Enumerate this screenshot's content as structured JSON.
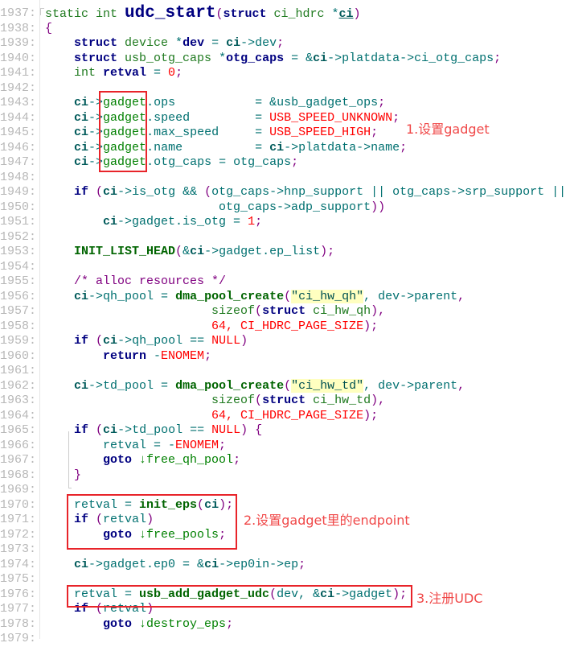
{
  "editor": {
    "lines": [
      {
        "n": "1937:",
        "t": [
          [
            "t",
            "static int "
          ],
          [
            "big",
            "udc_start"
          ],
          [
            "p",
            "("
          ],
          [
            "k",
            "struct"
          ],
          [
            "t",
            " ci_hdrc "
          ],
          [
            "o",
            "*"
          ],
          [
            "c u",
            "ci"
          ],
          [
            "p",
            ")"
          ]
        ]
      },
      {
        "n": "1938:",
        "t": [
          [
            "p",
            "{"
          ]
        ]
      },
      {
        "n": "1939:",
        "t": [
          [
            "t",
            "    "
          ],
          [
            "k",
            "struct"
          ],
          [
            "t",
            " device "
          ],
          [
            "o",
            "*"
          ],
          [
            "v",
            "dev"
          ],
          [
            "o",
            " = "
          ],
          [
            "c",
            "ci"
          ],
          [
            "m",
            "->dev"
          ],
          [
            "p",
            ";"
          ]
        ]
      },
      {
        "n": "1940:",
        "t": [
          [
            "t",
            "    "
          ],
          [
            "k",
            "struct"
          ],
          [
            "t",
            " usb_otg_caps "
          ],
          [
            "o",
            "*"
          ],
          [
            "v",
            "otg_caps"
          ],
          [
            "o",
            " = &"
          ],
          [
            "c",
            "ci"
          ],
          [
            "m",
            "->platdata->ci_otg_caps"
          ],
          [
            "p",
            ";"
          ]
        ]
      },
      {
        "n": "1941:",
        "t": [
          [
            "t",
            "    int "
          ],
          [
            "v",
            "retval"
          ],
          [
            "o",
            " = "
          ],
          [
            "n",
            "0"
          ],
          [
            "p",
            ";"
          ]
        ]
      },
      {
        "n": "1942:",
        "t": []
      },
      {
        "n": "1943:",
        "t": [
          [
            "t",
            "    "
          ],
          [
            "c",
            "ci"
          ],
          [
            "m",
            "->"
          ],
          [
            "g",
            "gadget"
          ],
          [
            "m",
            ".ops           = &usb_gadget_ops"
          ],
          [
            "p",
            ";"
          ]
        ]
      },
      {
        "n": "1944:",
        "t": [
          [
            "t",
            "    "
          ],
          [
            "c",
            "ci"
          ],
          [
            "m",
            "->"
          ],
          [
            "g",
            "gadget"
          ],
          [
            "m",
            ".speed         = "
          ],
          [
            "n",
            "USB_SPEED_UNKNOWN"
          ],
          [
            "p",
            ";"
          ]
        ]
      },
      {
        "n": "1945:",
        "t": [
          [
            "t",
            "    "
          ],
          [
            "c",
            "ci"
          ],
          [
            "m",
            "->"
          ],
          [
            "g",
            "gadget"
          ],
          [
            "m",
            ".max_speed     = "
          ],
          [
            "n",
            "USB_SPEED_HIGH"
          ],
          [
            "p",
            ";"
          ]
        ]
      },
      {
        "n": "1946:",
        "t": [
          [
            "t",
            "    "
          ],
          [
            "c",
            "ci"
          ],
          [
            "m",
            "->"
          ],
          [
            "g",
            "gadget"
          ],
          [
            "m",
            ".name          = "
          ],
          [
            "c",
            "ci"
          ],
          [
            "m",
            "->platdata->name"
          ],
          [
            "p",
            ";"
          ]
        ]
      },
      {
        "n": "1947:",
        "t": [
          [
            "t",
            "    "
          ],
          [
            "c",
            "ci"
          ],
          [
            "m",
            "->"
          ],
          [
            "g",
            "gadget"
          ],
          [
            "m",
            ".otg_caps = otg_caps"
          ],
          [
            "p",
            ";"
          ]
        ]
      },
      {
        "n": "1948:",
        "t": []
      },
      {
        "n": "1949:",
        "t": [
          [
            "t",
            "    "
          ],
          [
            "k",
            "if"
          ],
          [
            "p",
            " ("
          ],
          [
            "c",
            "ci"
          ],
          [
            "m",
            "->is_otg && "
          ],
          [
            "p",
            "("
          ],
          [
            "m",
            "otg_caps->hnp_support || otg_caps->srp_support ||"
          ]
        ]
      },
      {
        "n": "1950:",
        "t": [
          [
            "m",
            "                        otg_caps->adp_support"
          ],
          [
            "p",
            "))"
          ]
        ]
      },
      {
        "n": "1951:",
        "t": [
          [
            "t",
            "        "
          ],
          [
            "c",
            "ci"
          ],
          [
            "m",
            "->gadget.is_otg = "
          ],
          [
            "n",
            "1"
          ],
          [
            "p",
            ";"
          ]
        ]
      },
      {
        "n": "1952:",
        "t": []
      },
      {
        "n": "1953:",
        "t": [
          [
            "t",
            "    "
          ],
          [
            "f",
            "INIT_LIST_HEAD"
          ],
          [
            "p",
            "("
          ],
          [
            "o",
            "&"
          ],
          [
            "c",
            "ci"
          ],
          [
            "m",
            "->gadget.ep_list"
          ],
          [
            "p",
            ");"
          ]
        ]
      },
      {
        "n": "1954:",
        "t": []
      },
      {
        "n": "1955:",
        "t": [
          [
            "cm",
            "    /* alloc resources */"
          ]
        ]
      },
      {
        "n": "1956:",
        "t": [
          [
            "t",
            "    "
          ],
          [
            "c",
            "ci"
          ],
          [
            "m",
            "->qh_pool = "
          ],
          [
            "f",
            "dma_pool_create"
          ],
          [
            "p",
            "("
          ],
          [
            "s",
            "\"ci_hw_qh\""
          ],
          [
            "m",
            ", dev->parent"
          ],
          [
            "p",
            ","
          ]
        ]
      },
      {
        "n": "1957:",
        "t": [
          [
            "t",
            "                       sizeof"
          ],
          [
            "p",
            "("
          ],
          [
            "k",
            "struct"
          ],
          [
            "t",
            " ci_hw_qh"
          ],
          [
            "p",
            "),"
          ]
        ]
      },
      {
        "n": "1958:",
        "t": [
          [
            "n",
            "                       64, CI_HDRC_PAGE_SIZE"
          ],
          [
            "p",
            ");"
          ]
        ]
      },
      {
        "n": "1959:",
        "t": [
          [
            "t",
            "    "
          ],
          [
            "k",
            "if"
          ],
          [
            "p",
            " ("
          ],
          [
            "c",
            "ci"
          ],
          [
            "m",
            "->qh_pool == "
          ],
          [
            "n",
            "NULL"
          ],
          [
            "p",
            ")"
          ]
        ]
      },
      {
        "n": "1960:",
        "t": [
          [
            "t",
            "        "
          ],
          [
            "k",
            "return"
          ],
          [
            "m",
            " -"
          ],
          [
            "n",
            "ENOMEM"
          ],
          [
            "p",
            ";"
          ]
        ]
      },
      {
        "n": "1961:",
        "t": []
      },
      {
        "n": "1962:",
        "t": [
          [
            "t",
            "    "
          ],
          [
            "c",
            "ci"
          ],
          [
            "m",
            "->td_pool = "
          ],
          [
            "f",
            "dma_pool_create"
          ],
          [
            "p",
            "("
          ],
          [
            "s",
            "\"ci_hw_td\""
          ],
          [
            "m",
            ", dev->parent"
          ],
          [
            "p",
            ","
          ]
        ]
      },
      {
        "n": "1963:",
        "t": [
          [
            "t",
            "                       sizeof"
          ],
          [
            "p",
            "("
          ],
          [
            "k",
            "struct"
          ],
          [
            "t",
            " ci_hw_td"
          ],
          [
            "p",
            "),"
          ]
        ]
      },
      {
        "n": "1964:",
        "t": [
          [
            "n",
            "                       64, CI_HDRC_PAGE_SIZE"
          ],
          [
            "p",
            ");"
          ]
        ]
      },
      {
        "n": "1965:",
        "t": [
          [
            "t",
            "    "
          ],
          [
            "k",
            "if"
          ],
          [
            "p",
            " ("
          ],
          [
            "c",
            "ci"
          ],
          [
            "m",
            "->td_pool == "
          ],
          [
            "n",
            "NULL"
          ],
          [
            "p",
            ") {"
          ]
        ]
      },
      {
        "n": "1966:",
        "t": [
          [
            "m",
            "        retval = -"
          ],
          [
            "n",
            "ENOMEM"
          ],
          [
            "p",
            ";"
          ]
        ]
      },
      {
        "n": "1967:",
        "t": [
          [
            "t",
            "        "
          ],
          [
            "k",
            "goto"
          ],
          [
            "g",
            " ↓free_qh_pool"
          ],
          [
            "p",
            ";"
          ]
        ]
      },
      {
        "n": "1968:",
        "t": [
          [
            "p",
            "    }"
          ]
        ]
      },
      {
        "n": "1969:",
        "t": []
      },
      {
        "n": "1970:",
        "t": [
          [
            "m",
            "    retval = "
          ],
          [
            "f",
            "init_eps"
          ],
          [
            "p",
            "("
          ],
          [
            "c",
            "ci"
          ],
          [
            "p",
            ");"
          ]
        ]
      },
      {
        "n": "1971:",
        "t": [
          [
            "t",
            "    "
          ],
          [
            "k",
            "if"
          ],
          [
            "p",
            " ("
          ],
          [
            "m",
            "retval"
          ],
          [
            "p",
            ")"
          ]
        ]
      },
      {
        "n": "1972:",
        "t": [
          [
            "t",
            "        "
          ],
          [
            "k",
            "goto"
          ],
          [
            "g",
            " ↓free_pools"
          ],
          [
            "p",
            ";"
          ]
        ]
      },
      {
        "n": "1973:",
        "t": []
      },
      {
        "n": "1974:",
        "t": [
          [
            "t",
            "    "
          ],
          [
            "c",
            "ci"
          ],
          [
            "m",
            "->gadget.ep0 = &"
          ],
          [
            "c",
            "ci"
          ],
          [
            "m",
            "->ep0in->ep"
          ],
          [
            "p",
            ";"
          ]
        ]
      },
      {
        "n": "1975:",
        "t": []
      },
      {
        "n": "1976:",
        "t": [
          [
            "m",
            "    retval = "
          ],
          [
            "f",
            "usb_add_gadget_udc"
          ],
          [
            "p",
            "("
          ],
          [
            "m",
            "dev, &"
          ],
          [
            "c",
            "ci"
          ],
          [
            "m",
            "->gadget"
          ],
          [
            "p",
            ");"
          ]
        ]
      },
      {
        "n": "1977:",
        "t": [
          [
            "t",
            "    "
          ],
          [
            "k",
            "if"
          ],
          [
            "p",
            " ("
          ],
          [
            "m",
            "retval"
          ],
          [
            "p",
            ")"
          ]
        ]
      },
      {
        "n": "1978:",
        "t": [
          [
            "t",
            "        "
          ],
          [
            "k",
            "goto"
          ],
          [
            "g",
            " ↓destroy_eps"
          ],
          [
            "p",
            ";"
          ]
        ]
      },
      {
        "n": "1979:",
        "t": []
      }
    ]
  },
  "annotations": {
    "note1": "1.设置gadget",
    "note2": "2.设置gadget里的endpoint",
    "note3": "3.注册UDC",
    "color": "#e8242a"
  },
  "colors": {
    "keyword": "#000080",
    "constant": "#ff0000",
    "punctuation": "#800080",
    "function": "#006400",
    "string_bg": "#ffffc0"
  }
}
